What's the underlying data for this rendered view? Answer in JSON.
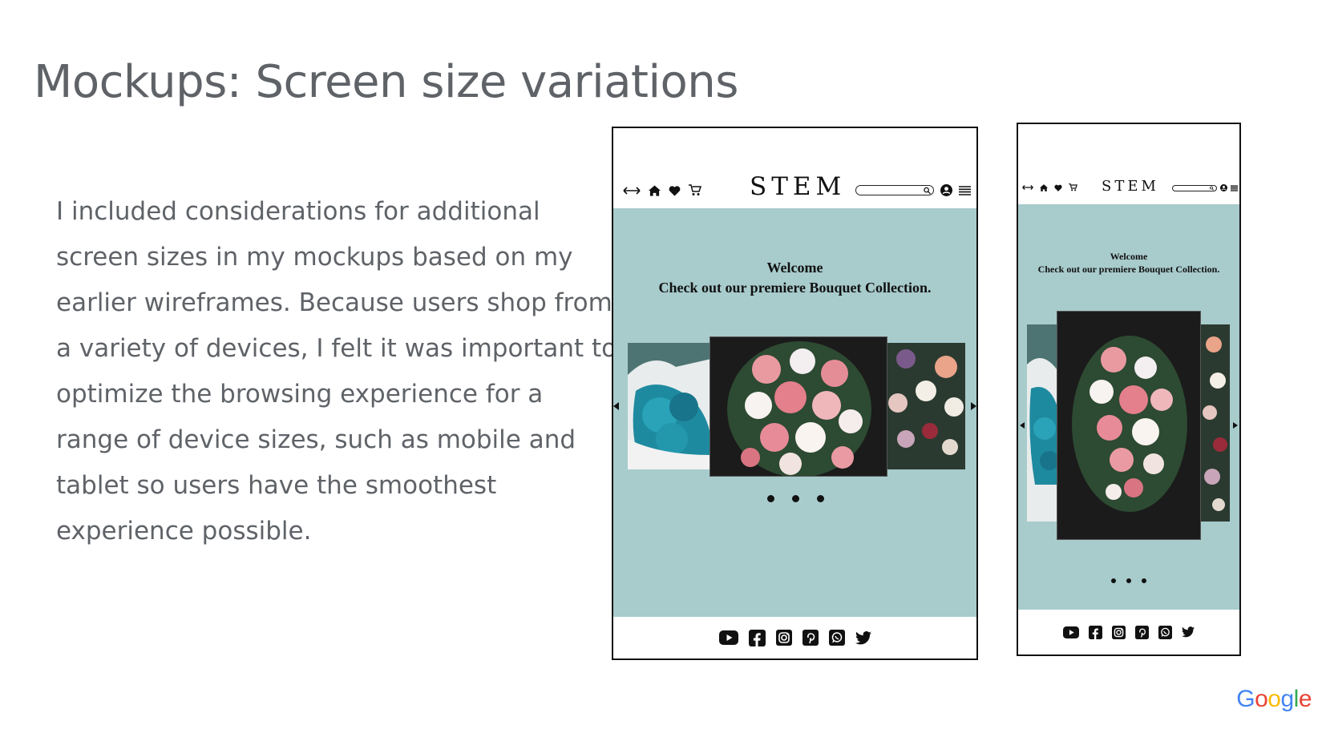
{
  "slide": {
    "title": "Mockups: Screen size variations",
    "body": "I included considerations for additional screen sizes in my mockups based on my earlier wireframes. Because users shop from a variety of devices, I felt it was important to optimize the browsing experience for a range of device sizes, such as mobile and tablet so users have the smoothest experience possible."
  },
  "tablet_mockup": {
    "brand": "STEM",
    "welcome_line1": "Welcome",
    "welcome_line2": "Check out our premiere Bouquet Collection.",
    "nav_icons": [
      "back-forward-icon",
      "home-icon",
      "heart-icon",
      "cart-icon"
    ],
    "right_icons": [
      "search-icon",
      "account-icon",
      "menu-icon"
    ],
    "social_icons": [
      "youtube-icon",
      "facebook-icon",
      "instagram-icon",
      "pinterest-icon",
      "whatsapp-icon",
      "twitter-icon"
    ]
  },
  "mobile_mockup": {
    "brand": "STEM",
    "welcome_line1": "Welcome",
    "welcome_line2": "Check out our premiere Bouquet Collection."
  },
  "footer_logo": "Google",
  "colors": {
    "accent_teal": "#a8cbcc",
    "title_gray": "#5f6368"
  }
}
